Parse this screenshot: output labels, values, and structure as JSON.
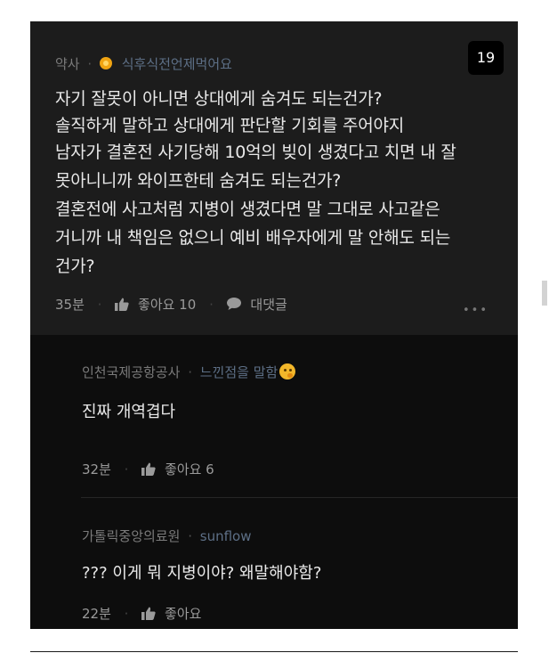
{
  "post": {
    "author": "약사",
    "separator": "·",
    "nickname": "식후식전언제먹어요",
    "badge_count": "19",
    "body_lines": [
      "자기 잘못이 아니면 상대에게 숨겨도 되는건가?",
      "솔직하게 말하고 상대에게 판단할 기회를 주어야지",
      "남자가 결혼전 사기당해 10억의 빚이 생겼다고 치면 내 잘",
      "못아니니까 와이프한테 숨겨도 되는건가?",
      "결혼전에 사고처럼 지병이 생겼다면 말 그대로 사고같은",
      "거니까 내 책임은 없으니 예비 배우자에게 말 안해도 되는",
      "건가?"
    ],
    "time": "35분",
    "like_label": "좋아요 10",
    "reply_label": "대댓글",
    "more_label": "•••"
  },
  "replies": [
    {
      "author": "인천국제공항공사",
      "nickname": "느낀점을 말함",
      "text": "진짜 개역겹다",
      "time": "32분",
      "like_label": "좋아요 6"
    },
    {
      "author": "가톨릭중앙의료원",
      "nickname": "sunflow",
      "text": "??? 이게 뭐 지병이야? 왜말해야함?",
      "time": "22분",
      "like_label": "좋아요"
    }
  ],
  "colors": {
    "panel_bg": "#1c1c1c",
    "reply_bg": "#0d0d0d",
    "nickname": "#5d6f86",
    "coin": "#f0a412"
  },
  "icons": {
    "coin": "coin-icon",
    "thumb": "thumbs-up-icon",
    "bubble": "speech-bubble-icon",
    "emoji": "thinking-face-icon"
  }
}
